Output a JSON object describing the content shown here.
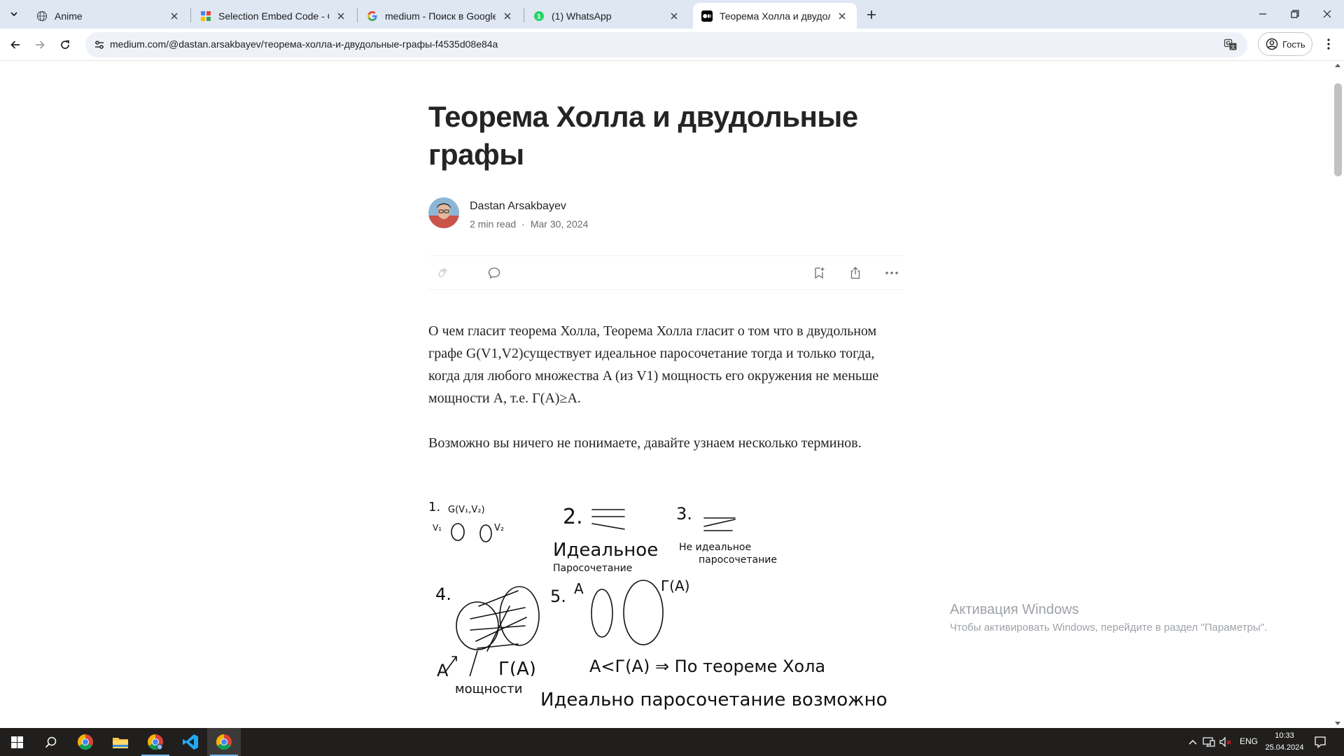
{
  "browser": {
    "tabs": [
      {
        "title": "Anime",
        "icon": "globe-icon",
        "active": false
      },
      {
        "title": "Selection Embed Code - Googl",
        "icon": "sheets-icon",
        "active": false
      },
      {
        "title": "medium - Поиск в Google",
        "icon": "google-icon",
        "active": false
      },
      {
        "title": "(1) WhatsApp",
        "icon": "whatsapp-icon",
        "active": false
      },
      {
        "title": "Теорема Холла и двудольны",
        "icon": "medium-icon",
        "active": true
      }
    ],
    "url": "medium.com/@dastan.arsakbayev/теорема-холла-и-двудольные-графы-f4535d08e84a",
    "profile_label": "Гость"
  },
  "article": {
    "title": "Теорема Холла и двудольные графы",
    "author": "Dastan Arsakbayev",
    "read_time": "2 min read",
    "date_sep": "·",
    "date": "Mar 30, 2024",
    "paragraphs": [
      "О чем гласит теорема Холла, Теорема Холла гласит о том что в двудольном графе G(V1,V2)существует идеальное паросочетание тогда и только тогда, когда для любого множества A (из V1) мощность его окружения не меньше мощности A, т.е. Г(A)≥A.",
      "Возможно вы ничего не понимаете, давайте узнаем несколько терминов."
    ],
    "sketch_labels": {
      "n1": "1.",
      "g": "G(V₁,V₂)",
      "v1": "V₁",
      "v2": "V₂",
      "n2": "2.",
      "ideal": "Идеальное",
      "matching": "Паросочетание",
      "n3": "3.",
      "not_ideal": "Не идеальное",
      "not_ideal_2": "паросочетание",
      "n4": "4.",
      "a_arrow": "A",
      "gamma_a": "Г(A)",
      "powers": "мощности",
      "n5": "5.",
      "a5": "A",
      "gamma5": "Г(A)",
      "formula": "A<Г(A) ⇒ По теореме Хола",
      "conclusion": "Идеально паросочетание возможно"
    }
  },
  "watermark": {
    "line1": "Активация Windows",
    "line2": "Чтобы активировать Windows, перейдите в раздел \"Параметры\"."
  },
  "taskbar": {
    "lang": "ENG",
    "time": "10:33",
    "date": "25.04.2024"
  },
  "colors": {
    "tab_strip": "#dfe7f3",
    "taskbar": "#201f1e",
    "text": "#242424",
    "muted": "#6b6b6b"
  }
}
